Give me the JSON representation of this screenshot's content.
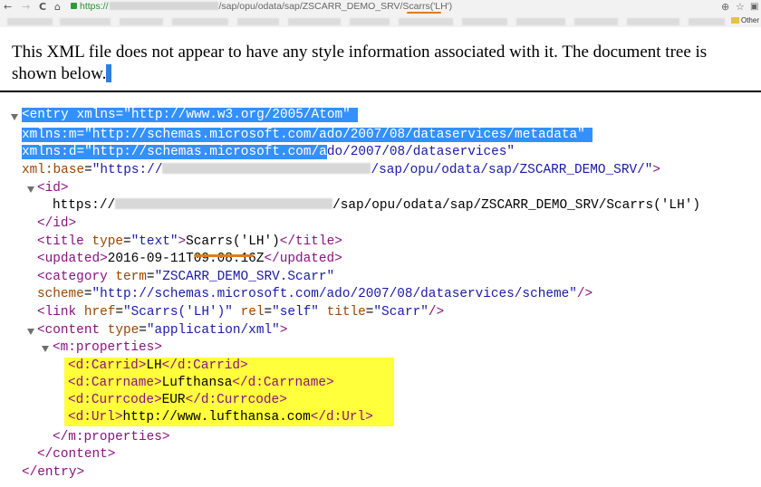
{
  "browser": {
    "back_glyph": "←",
    "forward_glyph": "→",
    "reload_glyph": "C",
    "home_glyph": "⌂",
    "url_scheme": "https://",
    "url_path": "/sap/opu/odata/sap/ZSCARR_DEMO_SRV/Scarrs('LH')",
    "zoom_glyph": "⊕",
    "star_glyph": "☆",
    "other_bookmarks": "Other",
    "accent_underline_color": "#e07b1f"
  },
  "info_message": "This XML file does not appear to have any style information associated with it. The document tree is shown below.",
  "xml": {
    "entry_open_tag": "<entry",
    "xmlns_attr": "xmlns",
    "xmlns_val": "\"http://www.w3.org/2005/Atom\"",
    "xmlns_m_attr": "xmlns:m",
    "xmlns_m_val": "\"http://schemas.microsoft.com/ado/2007/08/dataservices/metadata\"",
    "xmlns_d_attr": "xmlns:d",
    "xmlns_d_val_selected": "\"http://schemas.microsoft.com/a",
    "xmlns_d_val_rest": "do/2007/08/dataservices\"",
    "xml_base_attr": "xml:base",
    "xml_base_val_start": "\"https://",
    "xml_base_val_end": "/sap/opu/odata/sap/ZSCARR_DEMO_SRV/\"",
    "close_bracket": ">",
    "id_open": "<id>",
    "id_text_start": "https://",
    "id_text_end": "/sap/opu/odata/sap/ZSCARR_DEMO_SRV/Scarrs('LH')",
    "id_close": "</id>",
    "title_open": "<title",
    "title_type_attr": "type",
    "title_type_val": "\"text\"",
    "title_text": "Scarrs('LH')",
    "title_close": "</title>",
    "updated_open": "<updated>",
    "updated_text": "2016-09-11T09:08:16Z",
    "updated_close": "</updated>",
    "category_open": "<category",
    "category_term_attr": "term",
    "category_term_val": "\"ZSCARR_DEMO_SRV.Scarr\"",
    "category_scheme_attr": "scheme",
    "category_scheme_val": "\"http://schemas.microsoft.com/ado/2007/08/dataservices/scheme\"",
    "self_close": "/>",
    "link_open": "<link",
    "link_href_attr": "href",
    "link_href_val": "\"Scarrs('LH')\"",
    "link_rel_attr": "rel",
    "link_rel_val": "\"self\"",
    "link_title_attr": "title",
    "link_title_val": "\"Scarr\"",
    "content_open": "<content",
    "content_type_attr": "type",
    "content_type_val": "\"application/xml\"",
    "properties_open": "<m:properties>",
    "carrid_open": "<d:Carrid>",
    "carrid_val": "LH",
    "carrid_close": "</d:Carrid>",
    "carrname_open": "<d:Carrname>",
    "carrname_val": "Lufthansa",
    "carrname_close": "</d:Carrname>",
    "currcode_open": "<d:Currcode>",
    "currcode_val": "EUR",
    "currcode_close": "</d:Currcode>",
    "url_open": "<d:Url>",
    "url_val": "http://www.lufthansa.com",
    "url_close": "</d:Url>",
    "properties_close": "</m:properties>",
    "content_close": "</content>",
    "entry_close": "</entry>"
  }
}
